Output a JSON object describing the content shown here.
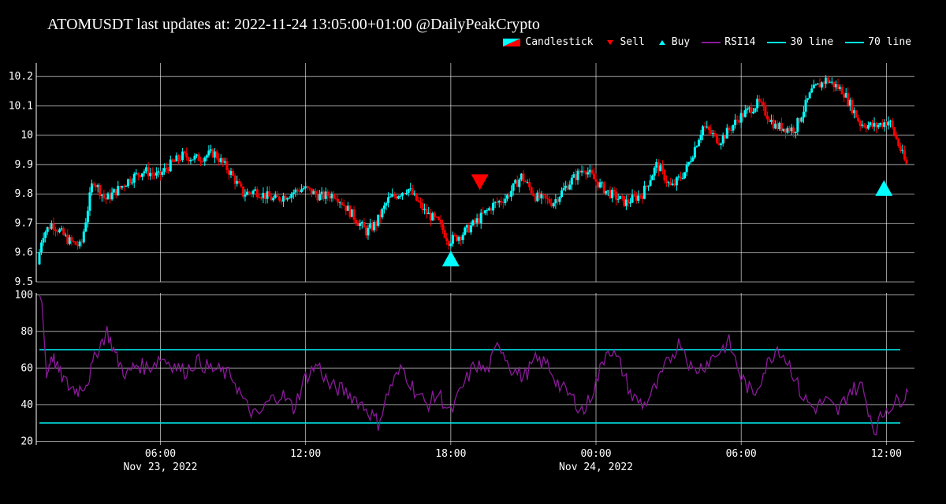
{
  "title": "ATOMUSDT last updates at: 2022-11-24 13:05:00+01:00 @DailyPeakCrypto",
  "legend": {
    "candlestick": "Candlestick",
    "sell": "Sell",
    "buy": "Buy",
    "rsi": "RSI14",
    "line30": "30 line",
    "line70": "70 line"
  },
  "colors": {
    "background": "#000000",
    "up": "#00ffff",
    "down": "#ff0000",
    "rsi": "#8b1a9b",
    "ref_lines": "#00e5e5",
    "grid": "#ffffff"
  },
  "chart_data": [
    {
      "type": "candlestick",
      "ylim": [
        9.5,
        10.23
      ],
      "yticks": [
        "9.5",
        "9.6",
        "9.7",
        "9.8",
        "9.9",
        "10",
        "10.1",
        "10.2"
      ],
      "grid": true,
      "time_range_hours": [
        1.0,
        36.9
      ],
      "price_path_hours": [
        1.0,
        1.2,
        1.6,
        2.3,
        2.8,
        3.3,
        3.8,
        4.4,
        4.8,
        5.4,
        6.0,
        6.5,
        7.0,
        7.6,
        8.3,
        9.0,
        9.5,
        10.0,
        10.8,
        11.4,
        12.0,
        12.7,
        13.3,
        14.0,
        14.6,
        15.0,
        15.5,
        16.3,
        17.0,
        17.6,
        18.0,
        18.5,
        19.2,
        19.8,
        20.4,
        21.0,
        21.6,
        22.3,
        23.0,
        23.6,
        24.0,
        24.5,
        25.3,
        26.0,
        26.6,
        27.2,
        27.8,
        28.5,
        29.2,
        30.0,
        30.8,
        31.5,
        32.3,
        33.0,
        33.6,
        34.3,
        35.0,
        35.6,
        36.2,
        36.9
      ],
      "price_path_values": [
        9.56,
        9.66,
        9.7,
        9.64,
        9.62,
        9.85,
        9.78,
        9.82,
        9.85,
        9.88,
        9.86,
        9.9,
        9.93,
        9.92,
        9.94,
        9.87,
        9.8,
        9.81,
        9.78,
        9.8,
        9.82,
        9.79,
        9.8,
        9.73,
        9.67,
        9.7,
        9.78,
        9.82,
        9.74,
        9.7,
        9.64,
        9.66,
        9.71,
        9.76,
        9.79,
        9.86,
        9.79,
        9.77,
        9.84,
        9.89,
        9.85,
        9.81,
        9.77,
        9.8,
        9.9,
        9.82,
        9.88,
        10.03,
        9.98,
        10.06,
        10.11,
        10.03,
        10.02,
        10.15,
        10.19,
        10.15,
        10.04,
        10.03,
        10.05,
        9.9
      ],
      "markers": [
        {
          "type": "Buy",
          "x_hours": 18.0,
          "y": 9.58
        },
        {
          "type": "Sell",
          "x_hours": 19.2,
          "y": 9.84
        },
        {
          "type": "Buy",
          "x_hours": 35.9,
          "y": 9.82
        }
      ]
    },
    {
      "type": "line",
      "name": "RSI14",
      "ylim": [
        18,
        101
      ],
      "yticks": [
        "20",
        "40",
        "60",
        "80",
        "100"
      ],
      "grid": true,
      "x_hours": [
        1.0,
        1.1,
        1.3,
        1.5,
        1.8,
        2.2,
        2.6,
        3.0,
        3.4,
        3.8,
        4.2,
        4.6,
        5.0,
        5.5,
        6.0,
        6.5,
        7.0,
        7.5,
        8.0,
        8.5,
        9.0,
        9.5,
        10.0,
        10.5,
        11.0,
        11.5,
        12.0,
        12.5,
        13.0,
        13.5,
        14.0,
        14.5,
        15.0,
        15.5,
        16.0,
        16.5,
        17.0,
        17.5,
        18.0,
        18.5,
        19.0,
        19.5,
        20.0,
        20.5,
        21.0,
        21.5,
        22.0,
        22.5,
        23.0,
        23.5,
        24.0,
        24.5,
        25.0,
        25.5,
        26.0,
        26.5,
        27.0,
        27.5,
        28.0,
        28.5,
        29.0,
        29.5,
        30.0,
        30.5,
        31.0,
        31.5,
        32.0,
        32.5,
        33.0,
        33.5,
        34.0,
        34.5,
        35.0,
        35.5,
        36.0,
        36.5,
        36.9
      ],
      "values": [
        100,
        96,
        55,
        68,
        58,
        50,
        48,
        53,
        70,
        80,
        65,
        56,
        62,
        60,
        66,
        62,
        58,
        64,
        60,
        58,
        55,
        40,
        33,
        42,
        46,
        38,
        55,
        62,
        50,
        48,
        44,
        38,
        30,
        50,
        60,
        48,
        40,
        46,
        35,
        50,
        62,
        58,
        74,
        60,
        55,
        64,
        62,
        50,
        44,
        36,
        52,
        72,
        62,
        44,
        40,
        50,
        64,
        75,
        58,
        62,
        68,
        74,
        55,
        45,
        60,
        72,
        62,
        45,
        38,
        42,
        36,
        48,
        50,
        26,
        38,
        42,
        47
      ]
    }
  ],
  "x_axis": {
    "ticks": [
      {
        "hours": 6.0,
        "label": "06:00",
        "sublabel": "Nov 23, 2022"
      },
      {
        "hours": 12.0,
        "label": "12:00",
        "sublabel": ""
      },
      {
        "hours": 18.0,
        "label": "18:00",
        "sublabel": ""
      },
      {
        "hours": 24.0,
        "label": "00:00",
        "sublabel": "Nov 24, 2022"
      },
      {
        "hours": 30.0,
        "label": "06:00",
        "sublabel": ""
      },
      {
        "hours": 36.0,
        "label": "12:00",
        "sublabel": ""
      }
    ]
  },
  "reference_lines": [
    {
      "name": "30 line",
      "y": 30
    },
    {
      "name": "70 line",
      "y": 70
    }
  ]
}
